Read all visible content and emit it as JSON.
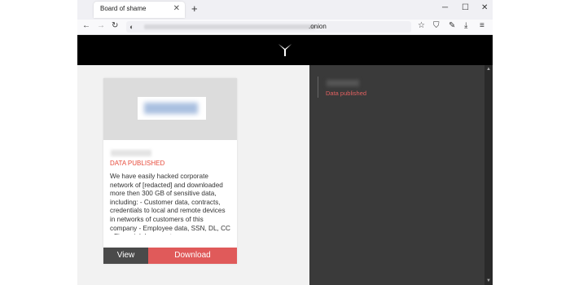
{
  "browser": {
    "tab_title": "Board of shame",
    "tab_close": "✕",
    "new_tab": "+",
    "minimize": "─",
    "maximize": "☐",
    "close": "✕"
  },
  "toolbar": {
    "back": "←",
    "forward": "→",
    "reload": "↻",
    "url_suffix": ".onion",
    "bookmark": "☆",
    "shield": "⛉",
    "extensions": "✎",
    "downloads": "⤓",
    "menu": "≡"
  },
  "card": {
    "status": "DATA PUBLISHED",
    "description": "We have easily hacked corporate network of [redacted] and downloaded more then 300 GB of sensitive data, including: - Customer data, contracts, credentials to local and remote devices in networks of customers of this company - Employee data, SSN, DL, CC - Financial documents",
    "view_label": "View",
    "download_label": "Download"
  },
  "side_panel": {
    "status": "Data published"
  },
  "colors": {
    "accent": "#e05a5a",
    "status_red": "#e74c3c"
  }
}
